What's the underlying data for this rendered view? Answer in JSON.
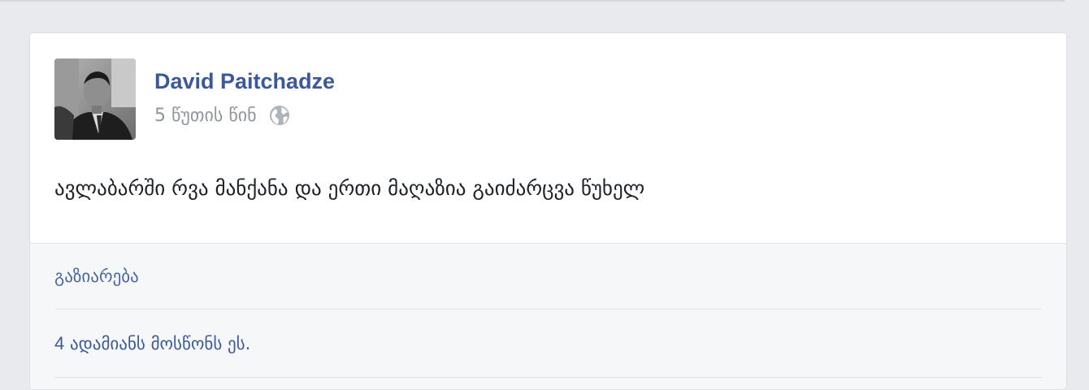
{
  "post": {
    "author_name": "David Paitchadze",
    "timestamp": "5 წუთის წინ",
    "privacy_icon": "globe-icon",
    "text": "ავლაბარში რვა მანქანა და ერთი მაღაზია გაიძარცვა წუხელ",
    "share_label": "გაზიარება",
    "likes_count": "4",
    "likes_text": "ადამიანს მოსწონს ეს."
  },
  "colors": {
    "link_blue": "#3b5998",
    "meta_gray": "#90949c",
    "page_bg": "#e9eaed",
    "footer_bg": "#f6f7f9"
  }
}
